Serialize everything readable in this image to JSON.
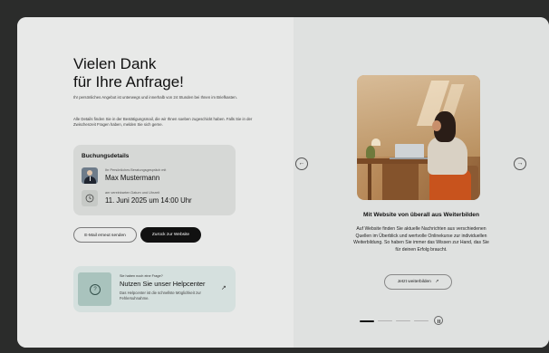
{
  "left": {
    "title_line1": "Vielen Dank",
    "title_line2": "für Ihre Anfrage!",
    "intro": "Ihr persönliches Angebot ist unterwegs und innerhalb von 24 Stunden bei Ihnen im Briefkasten.",
    "details": "Alle Details finden Sie in der Bestätigungsmail, die wir Ihnen soeben zugeschickt haben. Falls Sie in der Zwischenzeit Fragen haben, melden Sie sich gerne.",
    "booking": {
      "title": "Buchungsdetails",
      "advisor_caption": "Ihr Persönliches Beratungsgespräch mit",
      "advisor_name": "Max Mustermann",
      "date_caption": "am vereinbarten Datum und Uhrzeit",
      "date_value": "11. Juni 2025 um 14:00 Uhr"
    },
    "buttons": {
      "resend": "E-Mail erneut senden",
      "back": "Zurück zur Website"
    },
    "help": {
      "kicker": "Sie haben noch eine Frage?",
      "title": "Nutzen Sie unser Helpcenter",
      "description": "Das Helpcenter ist die schnellste Möglichkeit zur Fehlersuhnahme.",
      "arrow": "↗",
      "icon": "question-icon"
    }
  },
  "right": {
    "slide_title": "Mit Website von überall aus Weiterbilden",
    "slide_text": "Auf Website finden Sie aktuelle Nachrichten aus verschiedenen Quellen im Überblick und wertvolle Onlinekurse zur individuellen Weiterbildung. So haben Sie immer das Wissen zur Hand, das Sie für deinen Erfolg braucht.",
    "learn_button": "Jetzt weiterbilden",
    "learn_arrow": "↗",
    "prev_icon": "←",
    "next_icon": "→",
    "carousel": {
      "slides": 4,
      "active": 1
    }
  },
  "colors": {
    "background": "#2b2c2b",
    "left_panel": "#e8e9e8",
    "right_panel": "#dfe1e0",
    "booking_card": "#d6d8d6",
    "help_card": "#d5e0de",
    "primary_button": "#111111"
  }
}
